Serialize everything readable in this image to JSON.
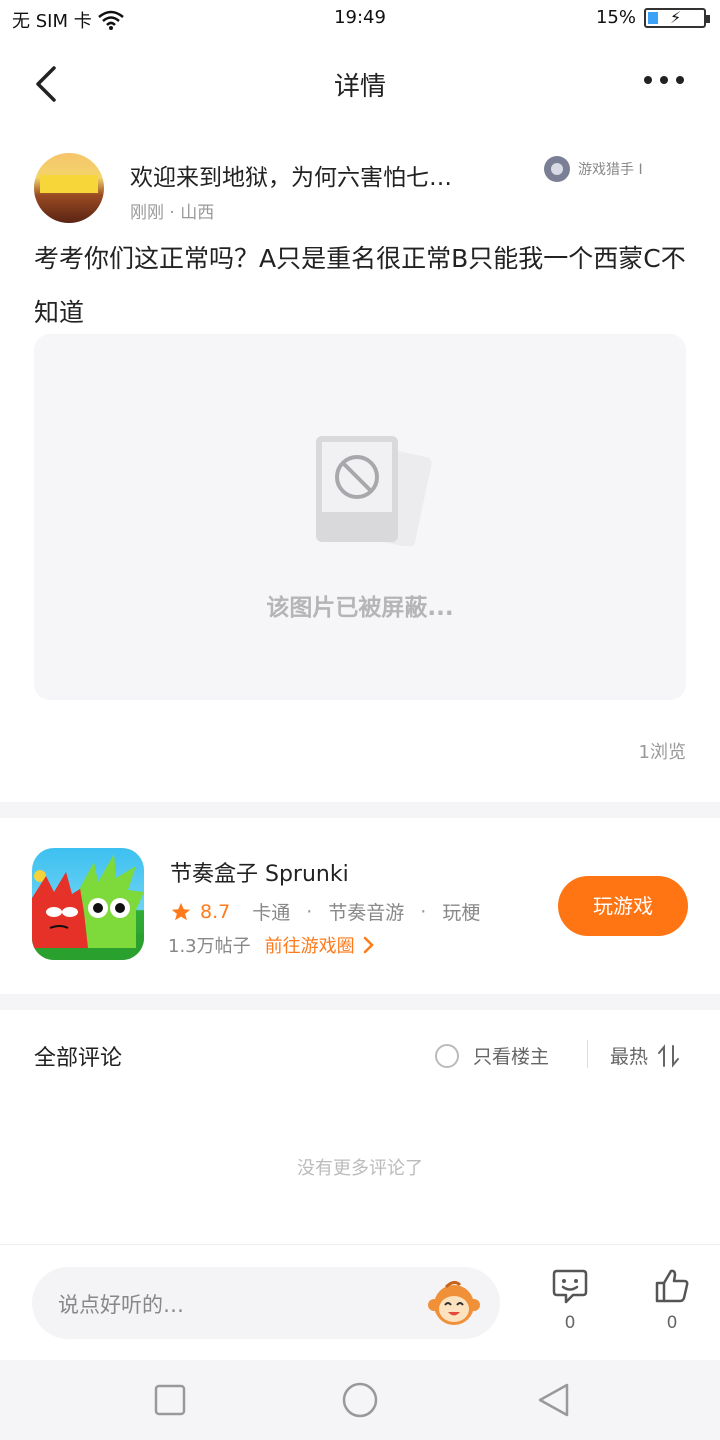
{
  "status": {
    "carrier": "无 SIM 卡",
    "time": "19:49",
    "battery": "15%"
  },
  "nav": {
    "title": "详情"
  },
  "post": {
    "title": "欢迎来到地狱，为何六害怕七…",
    "meta": "刚刚 · 山西",
    "tag": "游戏猎手 I",
    "body": "考考你们这正常吗？A只是重名很正常B只能我一个西蒙C不知道",
    "blocked_text": "该图片已被屏蔽...",
    "views": "1浏览"
  },
  "game": {
    "name": "节奏盒子 Sprunki",
    "score": "8.7",
    "tags": [
      "卡通",
      "节奏音游",
      "玩梗"
    ],
    "posts": "1.3万帖子",
    "goto_label": "前往游戏圈",
    "play_label": "玩游戏"
  },
  "comments": {
    "title": "全部评论",
    "owner_only_label": "只看楼主",
    "sort_label": "最热",
    "empty_text": "没有更多评论了"
  },
  "bottom_bar": {
    "input_placeholder": "说点好听的…",
    "comment_count": "0",
    "like_count": "0"
  },
  "colors": {
    "accent": "#ff7413",
    "star": "#ff7a1a"
  }
}
